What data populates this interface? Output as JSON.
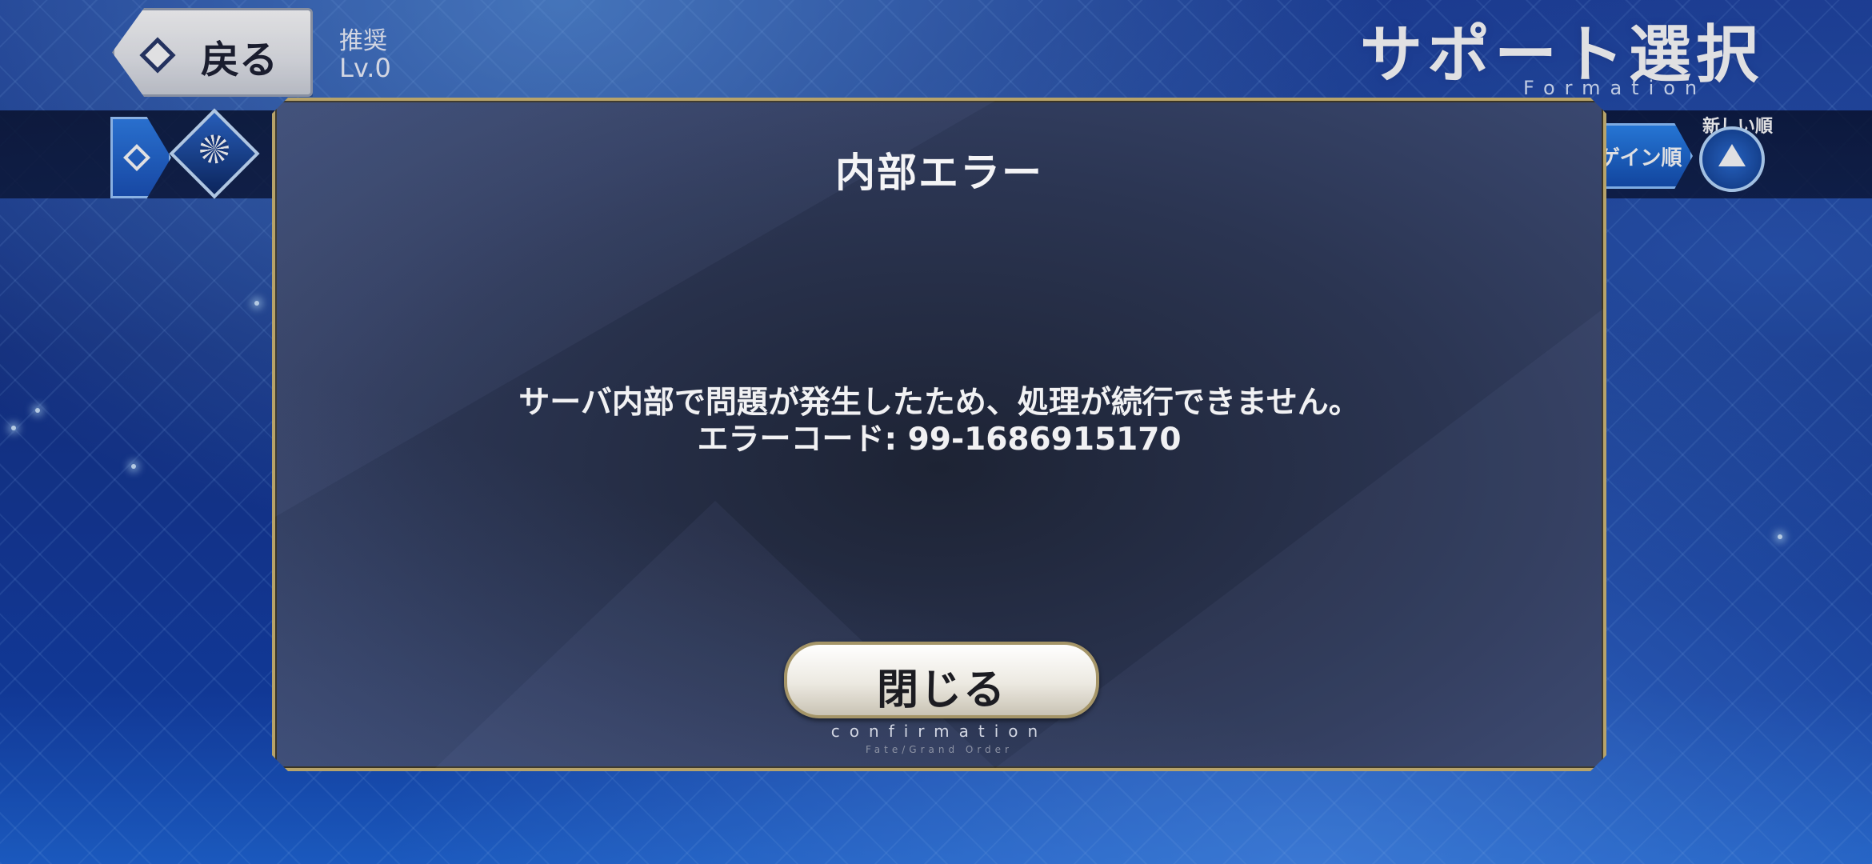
{
  "header": {
    "back_label": "戻る",
    "recommend_label": "推奨",
    "level": "Lv.0",
    "title": "サポート選択",
    "title_sub": "Formation"
  },
  "toolbar": {
    "sort_label": "ゲイン順",
    "order_label": "新しい順",
    "icons": [
      "diamond-arrow-icon",
      "class-all-icon",
      "triangle-up-icon"
    ]
  },
  "dialog": {
    "title": "内部エラー",
    "message_line1": "サーバ内部で問題が発生したため、処理が続行できません。",
    "message_line2": "エラーコード: 99-1686915170",
    "close_label": "閉じる",
    "confirm_sub": "confirmation",
    "brand_sub": "Fate/Grand Order"
  },
  "colors": {
    "dialog_border": "#b7a36a",
    "background_blue": "#16348a",
    "accent_blue": "#2b86ef"
  }
}
